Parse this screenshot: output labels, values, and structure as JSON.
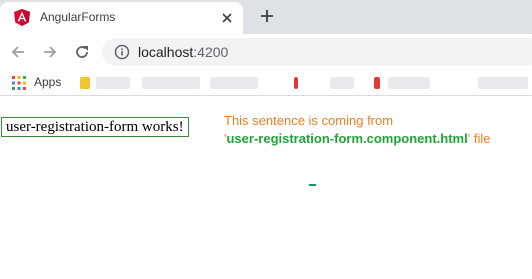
{
  "tab": {
    "title": "AngularForms",
    "favicon": "angular-logo-icon",
    "close_icon": "close-icon"
  },
  "new_tab_icon": "plus-icon",
  "toolbar": {
    "back_icon": "arrow-left-icon",
    "forward_icon": "arrow-right-icon",
    "reload_icon": "reload-icon",
    "info_icon": "info-icon",
    "url_host": "localhost",
    "url_port": ":4200"
  },
  "bookmarks": {
    "apps_label": "Apps",
    "apps_icon": "apps-grid-icon"
  },
  "content": {
    "component_text": "user-registration-form works!",
    "note_line1": "This sentence is coming from",
    "note_quote_open": "'",
    "note_filename": "user-registration-form.component.html",
    "note_quote_close": "' file"
  },
  "colors": {
    "tabstrip": "#dee1e6",
    "omnibox": "#f1f3f4",
    "note_orange": "#ef7d22",
    "note_green": "#21a335",
    "box_border": "#3c8c3c"
  }
}
